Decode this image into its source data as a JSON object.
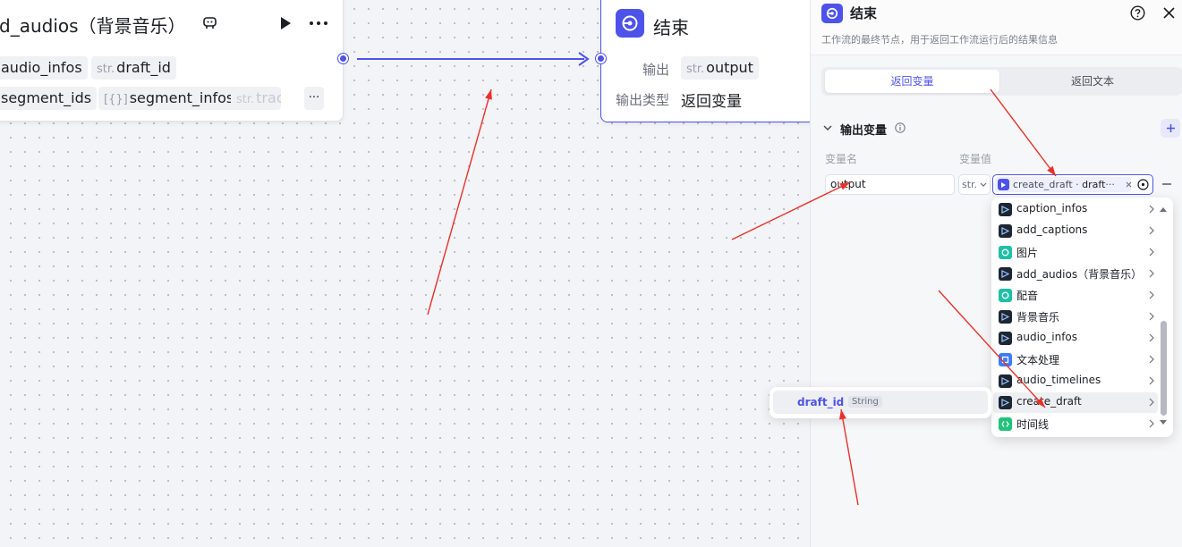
{
  "canvas": {
    "audio_node": {
      "title": "d_audios（背景音乐）",
      "chips": [
        {
          "pre": "",
          "label": "audio_infos"
        },
        {
          "pre": "str.",
          "label": "draft_id"
        },
        {
          "pre": "",
          "label": "segment_ids"
        },
        {
          "pre": "[{}]",
          "label": "segment_infos"
        },
        {
          "pre": "str.",
          "label": "trac"
        }
      ],
      "more": "···"
    },
    "end_node": {
      "title": "结束",
      "output_label": "输出",
      "output_pre": "str.",
      "output_value": "output",
      "type_label": "输出类型",
      "type_value": "返回变量"
    }
  },
  "panel": {
    "title": "结束",
    "description": "工作流的最终节点，用于返回工作流运行后的结果信息",
    "tabs": [
      {
        "label": "返回变量",
        "active": true
      },
      {
        "label": "返回文本",
        "active": false
      }
    ],
    "section_title": "输出变量",
    "col_name": "变量名",
    "col_value": "变量值",
    "variable": {
      "name": "output",
      "type": "str.",
      "ref_node": "create_draft",
      "ref_sep": " · ",
      "ref_field": "draft",
      "ref_ellipsis": "···"
    }
  },
  "dropdown": {
    "items": [
      {
        "label": "caption_infos",
        "icon": "dark"
      },
      {
        "label": "add_captions",
        "icon": "dark"
      },
      {
        "label": "图片",
        "icon": "teal"
      },
      {
        "label": "add_audios（背景音乐）",
        "icon": "dark"
      },
      {
        "label": "配音",
        "icon": "teal"
      },
      {
        "label": "背景音乐",
        "icon": "dark"
      },
      {
        "label": "audio_infos",
        "icon": "dark"
      },
      {
        "label": "文本处理",
        "icon": "blue"
      },
      {
        "label": "audio_timelines",
        "icon": "dark"
      },
      {
        "label": "create_draft",
        "icon": "dark",
        "hover": true
      },
      {
        "label": "时间线",
        "icon": "green"
      }
    ]
  },
  "sub_popup": {
    "name": "draft_id",
    "type": "String"
  },
  "colors": {
    "accent": "#4d53e8",
    "annotation": "#e8312a"
  }
}
